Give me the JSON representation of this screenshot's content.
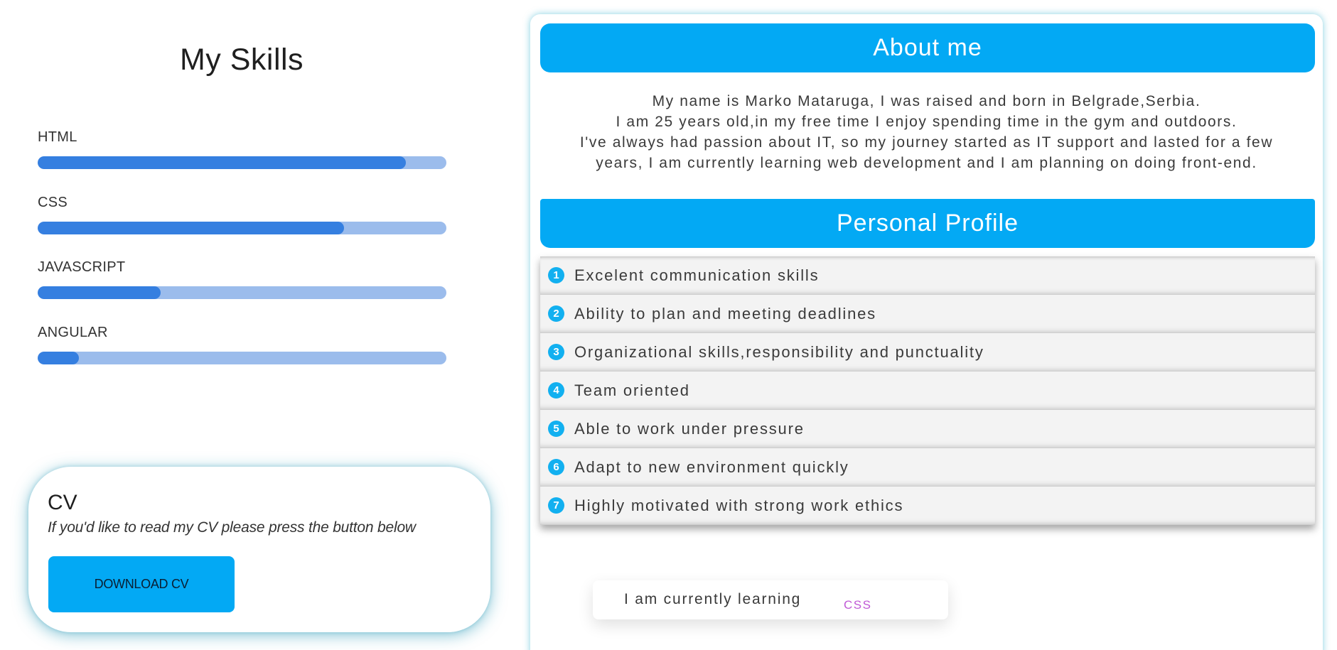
{
  "skills": {
    "title": "My Skills",
    "items": [
      {
        "label": "HTML",
        "level": 0.9
      },
      {
        "label": "CSS",
        "level": 0.75
      },
      {
        "label": "JAVASCRIPT",
        "level": 0.3
      },
      {
        "label": "ANGULAR",
        "level": 0.1
      }
    ]
  },
  "cv": {
    "title": "CV",
    "text": "If you'd like to read my CV please press the button below",
    "button_label": "DOWNLOAD CV"
  },
  "about": {
    "header": "About me",
    "lines": [
      "My name is Marko Mataruga, I was raised and born in Belgrade,Serbia.",
      "I am 25 years old,in my free time I enjoy spending time in the gym and outdoors.",
      "I've always had passion about IT, so my journey started as IT support and lasted for a few",
      "years, I am currently learning web development and I am planning on doing front-end."
    ]
  },
  "profile": {
    "header": "Personal Profile",
    "items": [
      {
        "num": "1",
        "text": "Excelent communication skills"
      },
      {
        "num": "2",
        "text": "Ability to plan and meeting deadlines"
      },
      {
        "num": "3",
        "text": "Organizational skills,responsibility and punctuality"
      },
      {
        "num": "4",
        "text": "Team oriented"
      },
      {
        "num": "5",
        "text": "Able to work under pressure"
      },
      {
        "num": "6",
        "text": "Adapt to new environment quickly"
      },
      {
        "num": "7",
        "text": "Highly motivated with strong work ethics"
      }
    ]
  },
  "learning": {
    "text": "I am currently learning",
    "current": "CSS"
  },
  "colors": {
    "accent": "#03a9f4",
    "bar_fill": "#357fe0",
    "bar_track": "#9bbcec",
    "learning_word": "#c05ad6"
  }
}
